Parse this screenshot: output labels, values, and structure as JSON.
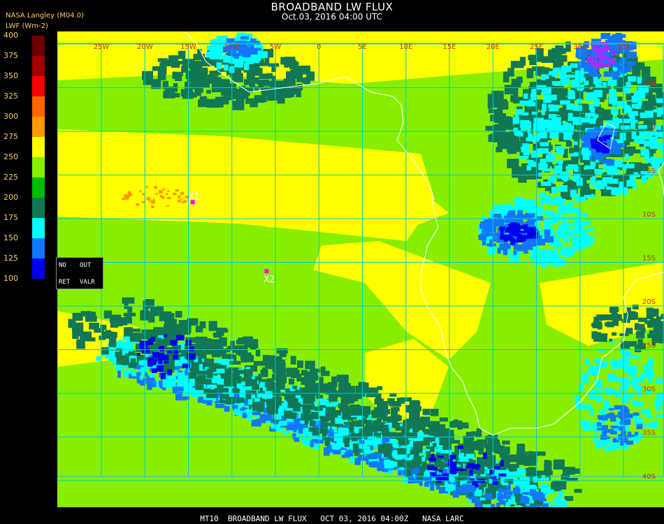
{
  "header": {
    "title": "BROADBAND LW FLUX",
    "subtitle": "Oct.03, 2016 04:00 UTC",
    "provider": "NASA Langley (M04.0)",
    "units": "LWF (Wm-2)"
  },
  "legend": {
    "levels": [
      "400",
      "375",
      "350",
      "325",
      "300",
      "275",
      "250",
      "225",
      "200",
      "175",
      "150",
      "125",
      "100"
    ],
    "colors": [
      "#6b0000",
      "#a00000",
      "#ff0000",
      "#ff6600",
      "#ff9900",
      "#ffff00",
      "#88ee00",
      "#00bb00",
      "#117755",
      "#00ffff",
      "#1177ff",
      "#0000ee",
      "#9933ff"
    ]
  },
  "controls": {
    "no": "NO",
    "out": "OUT",
    "ret": "RET",
    "valr": "VALR"
  },
  "map": {
    "lon_labels": [
      "25W",
      "20W",
      "15W",
      "10W",
      "5W",
      "0",
      "5E",
      "10E",
      "15E",
      "20E",
      "25E",
      "30E",
      "35E"
    ],
    "lat_labels": [
      "5N",
      "0",
      "5S",
      "10S",
      "15S",
      "20S",
      "25S",
      "30S",
      "35S",
      "40S"
    ],
    "markers": [
      {
        "label": "X1",
        "lon": -14.5,
        "lat": -8.1
      },
      {
        "label": "X2",
        "lon": -6.0,
        "lat": -16.0
      }
    ],
    "grid_color": "#00cccc",
    "label_color": "#cc3300"
  },
  "footer": {
    "text": "MT10  BROADBAND LW FLUX   OCT 03, 2016 04:00Z   NASA LARC"
  }
}
